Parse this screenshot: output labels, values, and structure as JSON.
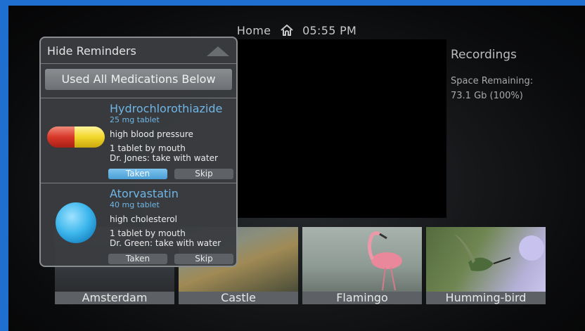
{
  "topbar": {
    "home_label": "Home",
    "time": "05:55 PM",
    "home_icon": "home-icon"
  },
  "recordings": {
    "title": "Recordings",
    "space_label": "Space Remaining:",
    "space_value": "73.1 Gb (100%)"
  },
  "thumbnails": [
    {
      "caption": "Amsterdam"
    },
    {
      "caption": "Castle"
    },
    {
      "caption": "Flamingo"
    },
    {
      "caption": "Humming-bird"
    }
  ],
  "reminders": {
    "hide_label": "Hide Reminders",
    "used_all_label": "Used All Medications Below",
    "medications": [
      {
        "name": "Hydrochlorothiazide",
        "dose": "25 mg tablet",
        "condition": "high blood pressure",
        "route": "1 tablet by mouth",
        "note": "Dr. Jones: take with water",
        "taken_label": "Taken",
        "skip_label": "Skip",
        "status": "taken",
        "icon": "capsule-icon"
      },
      {
        "name": "Atorvastatin",
        "dose": "40 mg tablet",
        "condition": "high cholesterol",
        "route": "1 tablet by mouth",
        "note": "Dr. Green: take with water",
        "taken_label": "Taken",
        "skip_label": "Skip",
        "status": "none",
        "icon": "round-pill-icon"
      }
    ]
  },
  "colors": {
    "accent": "#6fb6e6",
    "frame_border": "#1f6fd0"
  }
}
